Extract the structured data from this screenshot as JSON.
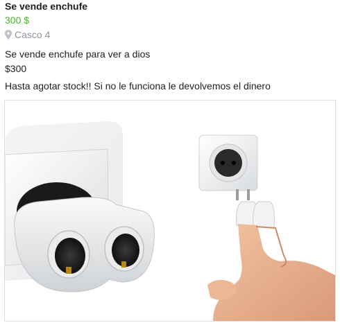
{
  "listing": {
    "title": "Se vende enchufe",
    "price": "300 $",
    "location": "Casco 4",
    "location_icon": "map-pin-icon",
    "description": [
      "Se vende enchufe para ver a dios",
      "$300",
      "Hasta agotar stock!! Si no le funciona le devolvemos el dinero"
    ],
    "photo": {
      "subject": "double socket adapter and hand with fingers in wall socket",
      "socket_color": "#e6e8ea",
      "wall_color": "#f3f4f5"
    }
  },
  "colors": {
    "title": "#1c1e21",
    "price": "#42b72a",
    "muted": "#90949c",
    "border": "#dddfe2"
  }
}
